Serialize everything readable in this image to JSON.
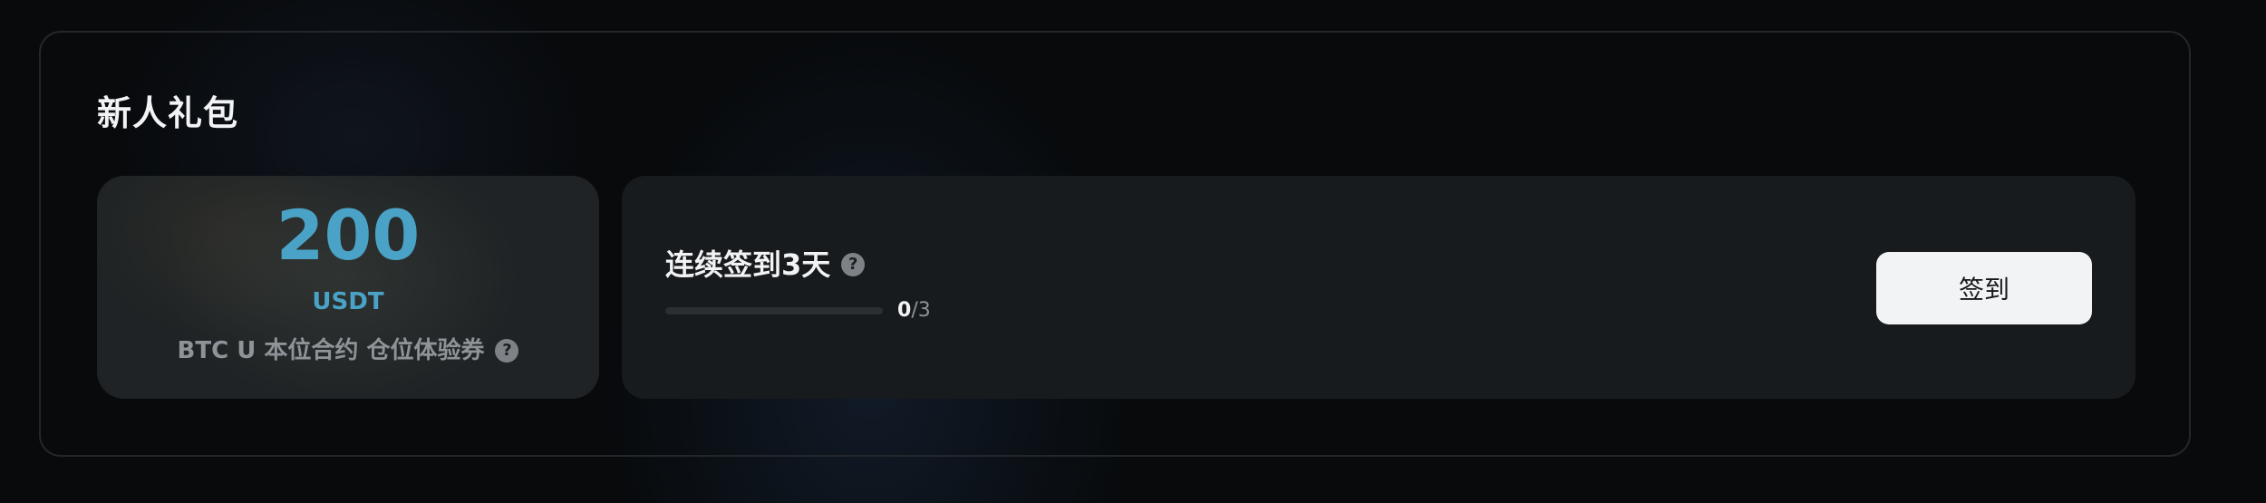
{
  "card": {
    "title": "新人礼包"
  },
  "voucher": {
    "amount": "200",
    "unit": "USDT",
    "description": "BTC U 本位合约 仓位体验券",
    "help_icon": "question-circle-icon"
  },
  "checkin": {
    "title": "连续签到3天",
    "help_icon": "question-circle-icon",
    "progress": {
      "current": "0",
      "separator": "/",
      "total": "3",
      "fraction": 0
    },
    "button_label": "签到"
  },
  "colors": {
    "accent": "#4aa3c6",
    "background": "#080a0c",
    "panel": "#181b1d",
    "button_bg": "#f2f3f5"
  }
}
